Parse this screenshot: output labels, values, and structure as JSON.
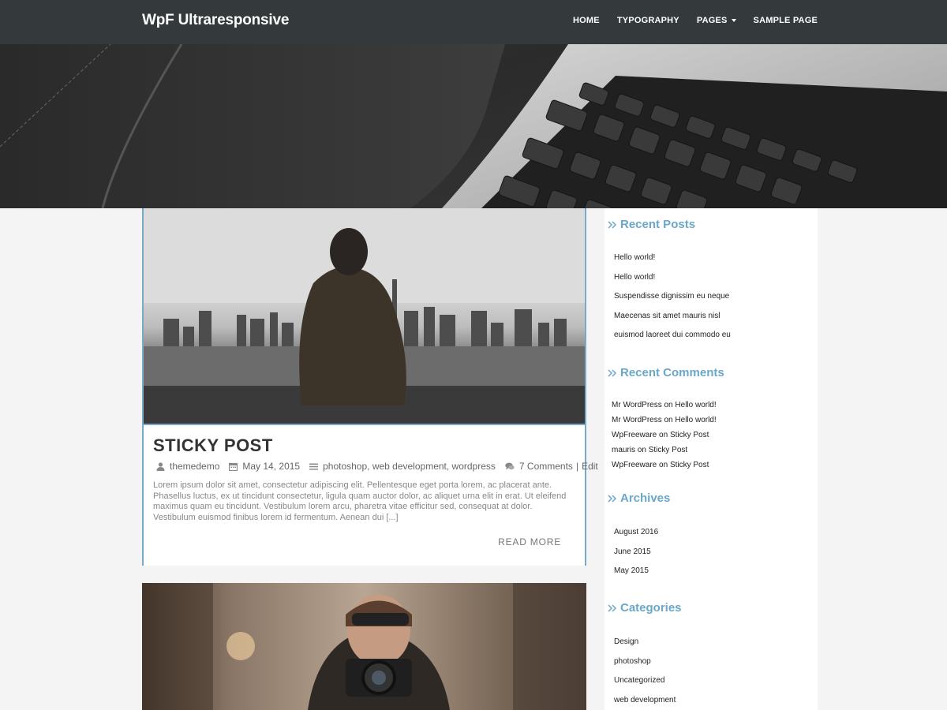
{
  "site": {
    "brand": "WpF Ultraresponsive"
  },
  "nav": {
    "items": [
      {
        "label": "HOME"
      },
      {
        "label": "TYPOGRAPHY"
      },
      {
        "label": "PAGES",
        "has_dropdown": true
      },
      {
        "label": "SAMPLE PAGE"
      }
    ]
  },
  "posts": [
    {
      "title": "STICKY POST",
      "author": "themedemo",
      "date": "May 14, 2015",
      "categories": "photoshop, web development, wordpress",
      "comments": "7 Comments",
      "separator": "|",
      "edit": "Edit",
      "excerpt": "Lorem ipsum dolor sit amet, consectetur adipiscing elit. Pellentesque eget porta lorem, ac placerat ante. Phasellus luctus, ex ut tincidunt consectetur, ligula quam auctor dolor, ac aliquet urna elit in erat. Ut eleifend maximus quam eu tincidunt. Vestibulum lorem arcu, pharetra vitae efficitur sed, consequat at dolor. Vestibulum euismod finibus lorem id fermentum. Aenean dui [...]",
      "read_more": "READ MORE"
    }
  ],
  "sidebar": {
    "recent_posts": {
      "title": "Recent Posts",
      "items": [
        "Hello world!",
        "Hello world!",
        "Suspendisse dignissim eu neque",
        "Maecenas sit amet mauris nisl",
        "euismod laoreet dui commodo eu"
      ]
    },
    "recent_comments": {
      "title": "Recent Comments",
      "on": "on",
      "items": [
        {
          "author": "Mr WordPress",
          "post": "Hello world!"
        },
        {
          "author": "Mr WordPress",
          "post": "Hello world!"
        },
        {
          "author": "WpFreeware",
          "post": "Sticky Post"
        },
        {
          "author": "mauris",
          "post": "Sticky Post"
        },
        {
          "author": "WpFreeware",
          "post": "Sticky Post"
        }
      ]
    },
    "archives": {
      "title": "Archives",
      "items": [
        "August 2016",
        "June 2015",
        "May 2015"
      ]
    },
    "categories": {
      "title": "Categories",
      "items": [
        "Design",
        "photoshop",
        "Uncategorized",
        "web development"
      ]
    }
  },
  "colors": {
    "navbar": "#343a3c",
    "accent": "#6aa7c8",
    "post_border": "#78a9c9",
    "page_bg": "#f4f4f4"
  }
}
